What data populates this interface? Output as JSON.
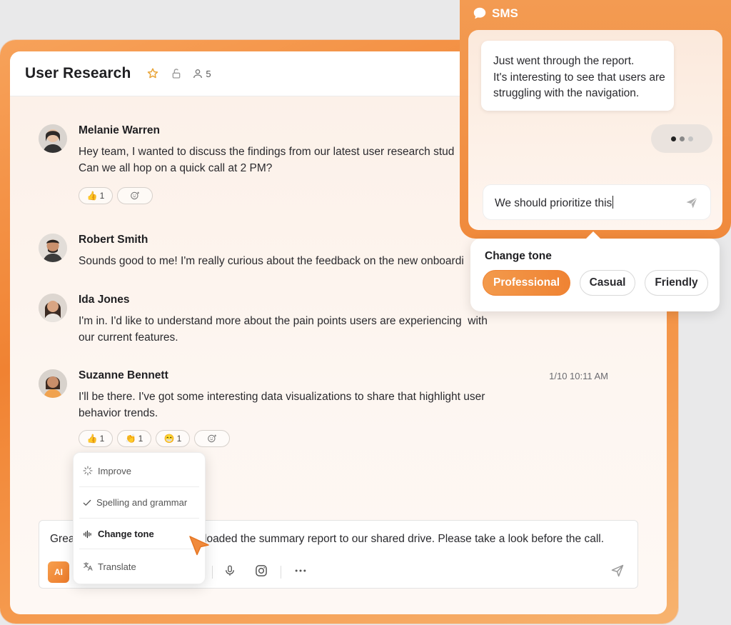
{
  "chat": {
    "title": "User Research",
    "members_count": "5",
    "messages": [
      {
        "author": "Melanie Warren",
        "text": "Hey team, I wanted to discuss the findings from our latest user research stud\nCan we all hop on a quick call at 2 PM?",
        "reactions": [
          {
            "emoji": "👍",
            "count": "1"
          }
        ]
      },
      {
        "author": "Robert Smith",
        "text": "Sounds good to me! I'm really curious about the feedback on the new onboardi"
      },
      {
        "author": "Ida Jones",
        "text": "I'm in. I'd like to understand more about the pain points users are experiencing  with\nour current features."
      },
      {
        "author": "Suzanne Bennett",
        "time": "1/10 10:11 AM",
        "text": "I'll be there. I've got some interesting data visualizations to share that highlight user\nbehavior trends.",
        "reactions": [
          {
            "emoji": "👍",
            "count": "1"
          },
          {
            "emoji": "👏",
            "count": "1"
          },
          {
            "emoji": "😁",
            "count": "1"
          }
        ]
      }
    ],
    "composer": {
      "text_start": "Grea",
      "text_end": "loaded the summary report to our shared drive. Please take a look before the call.",
      "ai_label": "AI"
    }
  },
  "ai_menu": {
    "items": [
      {
        "label": "Improve",
        "icon": "sparkle-icon"
      },
      {
        "label": "Spelling and grammar",
        "icon": "check-icon"
      },
      {
        "label": "Change tone",
        "icon": "waveform-icon",
        "active": true
      },
      {
        "label": "Translate",
        "icon": "translate-icon"
      }
    ]
  },
  "sms": {
    "title": "SMS",
    "incoming": "Just went through the report.\nIt's interesting to see that users are\nstruggling with the navigation.",
    "input_value": "We should prioritize this"
  },
  "tone": {
    "title": "Change tone",
    "options": [
      "Professional",
      "Casual",
      "Friendly"
    ],
    "selected": "Professional"
  },
  "colors": {
    "accent": "#f08a3c",
    "accent_dark": "#ec7a2a",
    "background": "#e9e9ea"
  }
}
